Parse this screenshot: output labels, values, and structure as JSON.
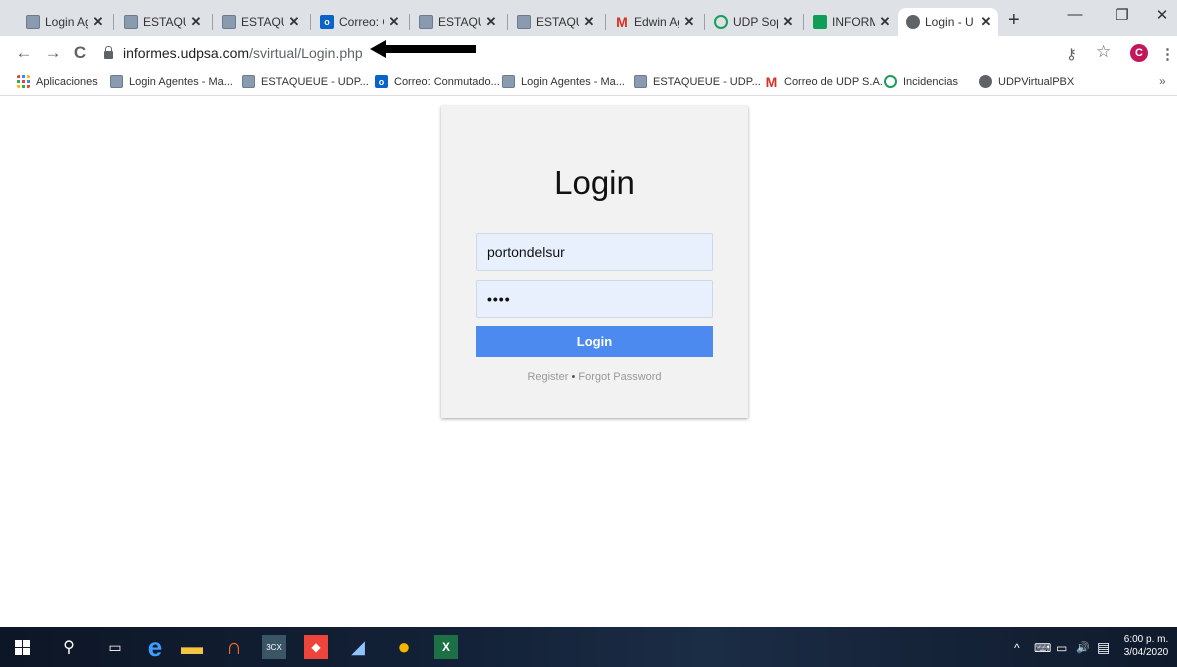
{
  "browser": {
    "tabs": [
      {
        "title": "Login Ag",
        "icon": "grid-favicon-icon"
      },
      {
        "title": "ESTAQUE",
        "icon": "grid-favicon-icon"
      },
      {
        "title": "ESTAQUE",
        "icon": "grid-favicon-icon"
      },
      {
        "title": "Correo: C",
        "icon": "outlook-icon"
      },
      {
        "title": "ESTAQUE",
        "icon": "grid-favicon-icon"
      },
      {
        "title": "ESTAQUE",
        "icon": "grid-favicon-icon"
      },
      {
        "title": "Edwin Ag",
        "icon": "gmail-icon"
      },
      {
        "title": "UDP Sop",
        "icon": "udp-icon"
      },
      {
        "title": "INFORME",
        "icon": "sheets-icon"
      },
      {
        "title": "Login - U",
        "icon": "globe-icon",
        "active": true
      }
    ],
    "close_glyph": "✕",
    "new_tab_glyph": "+",
    "outlook_glyph": "o",
    "gmail_glyph": "M",
    "window_controls": {
      "minimize": "—",
      "restore": "❐",
      "close": "✕"
    },
    "url": {
      "host": "informes.udpsa.com",
      "path": "/svirtual/Login.php"
    },
    "avatar_letter": "C",
    "toolbar_icons": {
      "key": "⚷",
      "star": "☆",
      "menu": "⋮"
    },
    "nav": {
      "back": "←",
      "forward": "→",
      "reload": "C"
    },
    "bookmarks": [
      {
        "label": "Aplicaciones",
        "icon": "apps-icon"
      },
      {
        "label": "Login Agentes - Ma...",
        "icon": "grid-favicon-icon"
      },
      {
        "label": "ESTAQUEUE - UDP...",
        "icon": "grid-favicon-icon"
      },
      {
        "label": "Correo: Conmutado...",
        "icon": "outlook-icon"
      },
      {
        "label": "Login Agentes - Ma...",
        "icon": "grid-favicon-icon"
      },
      {
        "label": "ESTAQUEUE - UDP...",
        "icon": "grid-favicon-icon"
      },
      {
        "label": "Correo de UDP S.A.",
        "icon": "gmail-icon"
      },
      {
        "label": "Incidencias",
        "icon": "udp-icon"
      },
      {
        "label": "UDPVirtualPBX",
        "icon": "globe-icon"
      }
    ],
    "bookmarks_more": "»"
  },
  "login": {
    "title": "Login",
    "username_value": "portondelsur",
    "password_mask": "••••",
    "button_label": "Login",
    "register_label": "Register",
    "separator": "•",
    "forgot_label": "Forgot Password"
  },
  "taskbar": {
    "time": "6:00 p. m.",
    "date": "3/04/2020",
    "tray": {
      "chevron": "^",
      "network": "⌨",
      "volume": "🔊",
      "notifications": "▤"
    },
    "apps": [
      {
        "name": "search-icon",
        "glyph": "⚲"
      },
      {
        "name": "task-view-icon",
        "glyph": "▭"
      },
      {
        "name": "edge-icon",
        "glyph": "e"
      },
      {
        "name": "file-explorer-icon",
        "glyph": "▬"
      },
      {
        "name": "app-headset-icon",
        "glyph": "∩"
      },
      {
        "name": "3cx-icon",
        "glyph": "3CX"
      },
      {
        "name": "anydesk-icon",
        "glyph": "◆"
      },
      {
        "name": "app-blue-icon",
        "glyph": "◢"
      },
      {
        "name": "chrome-icon",
        "glyph": "●"
      },
      {
        "name": "excel-icon",
        "glyph": "X"
      }
    ]
  },
  "colors": {
    "tabstrip": "#dee1e6",
    "login_button": "#4d8af0",
    "input_fill": "#e8f0fe",
    "card_bg": "#f2f2f2"
  }
}
